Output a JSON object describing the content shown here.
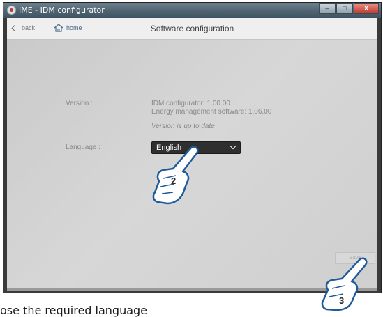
{
  "window": {
    "title": "IME - IDM configurator",
    "controls": {
      "minimize": "–",
      "maximize": "□",
      "close": "X"
    }
  },
  "topbar": {
    "back_label": "back",
    "home_label": "home",
    "page_title": "Software configuration"
  },
  "version": {
    "label": "Version :",
    "configurator": "IDM configurator: 1.00.00",
    "energy_software": "Energy management software: 1.06.00",
    "status": "Version is up to date"
  },
  "language": {
    "label": "Language :",
    "selected": "English"
  },
  "save_label": "Save",
  "callouts": {
    "step2": "2",
    "step3": "3"
  },
  "caption": "ose the required language"
}
